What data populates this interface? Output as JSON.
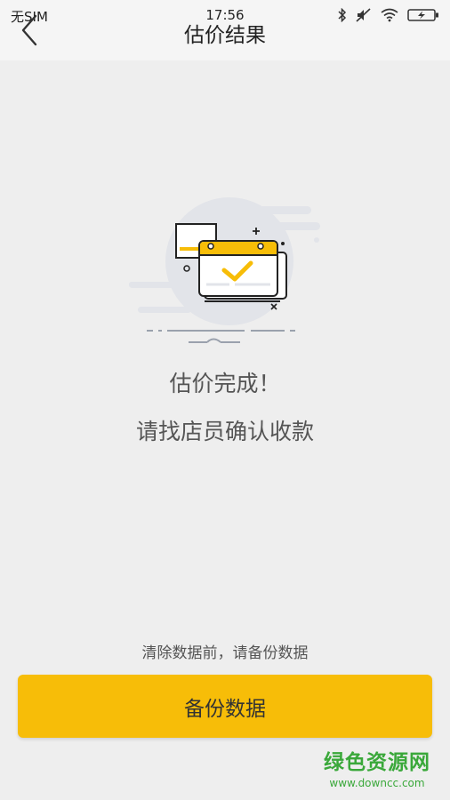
{
  "status_bar": {
    "carrier": "无SIM",
    "time": "17:56",
    "icons": [
      "bluetooth-icon",
      "mute-icon",
      "wifi-icon",
      "battery-charging-icon"
    ]
  },
  "header": {
    "back_icon": "chevron-left-icon",
    "title": "估价结果"
  },
  "main": {
    "illustration": "calendar-check-icon",
    "message_line1": "估价完成！",
    "message_line2": "请找店员确认收款"
  },
  "footer": {
    "hint": "清除数据前，请备份数据",
    "backup_button_label": "备份数据"
  },
  "watermark": {
    "main": "绿色资源网",
    "sub": "www.downcc.com"
  },
  "colors": {
    "accent": "#f7bd08",
    "background": "#eeeeee",
    "watermark": "#3aa83a"
  }
}
